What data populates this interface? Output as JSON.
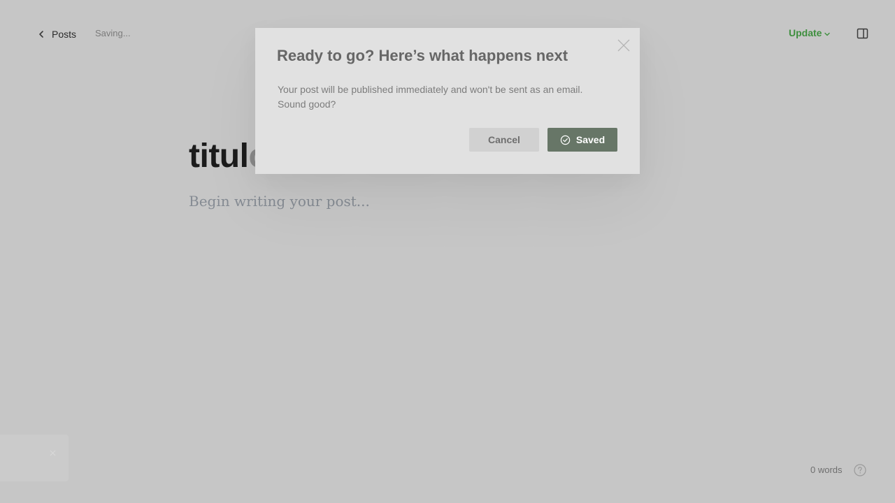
{
  "header": {
    "back_label": "Posts",
    "status": "Saving...",
    "update_label": "Update"
  },
  "editor": {
    "title_main": "titul",
    "title_faded": "o",
    "body_placeholder": "Begin writing your post..."
  },
  "modal": {
    "title": "Ready to go? Here’s what happens next",
    "text_line1": "Your post will be published immediately and won't be sent as an email.",
    "text_line2": "Sound good?",
    "cancel_label": "Cancel",
    "confirm_label": "Saved"
  },
  "footer": {
    "word_count": "0 words"
  },
  "colors": {
    "accent": "#3f8f3f",
    "overlay_bg": "#c6c6c6",
    "modal_bg": "#e1e1e1",
    "saved_button_bg": "#677667"
  },
  "icons": {
    "back": "chevron-left-icon",
    "update_dropdown": "chevron-down-icon",
    "sidebar": "sidebar-toggle-icon",
    "modal_close": "close-icon",
    "saved": "check-circle-icon",
    "toast_close": "close-icon",
    "help": "help-icon"
  }
}
